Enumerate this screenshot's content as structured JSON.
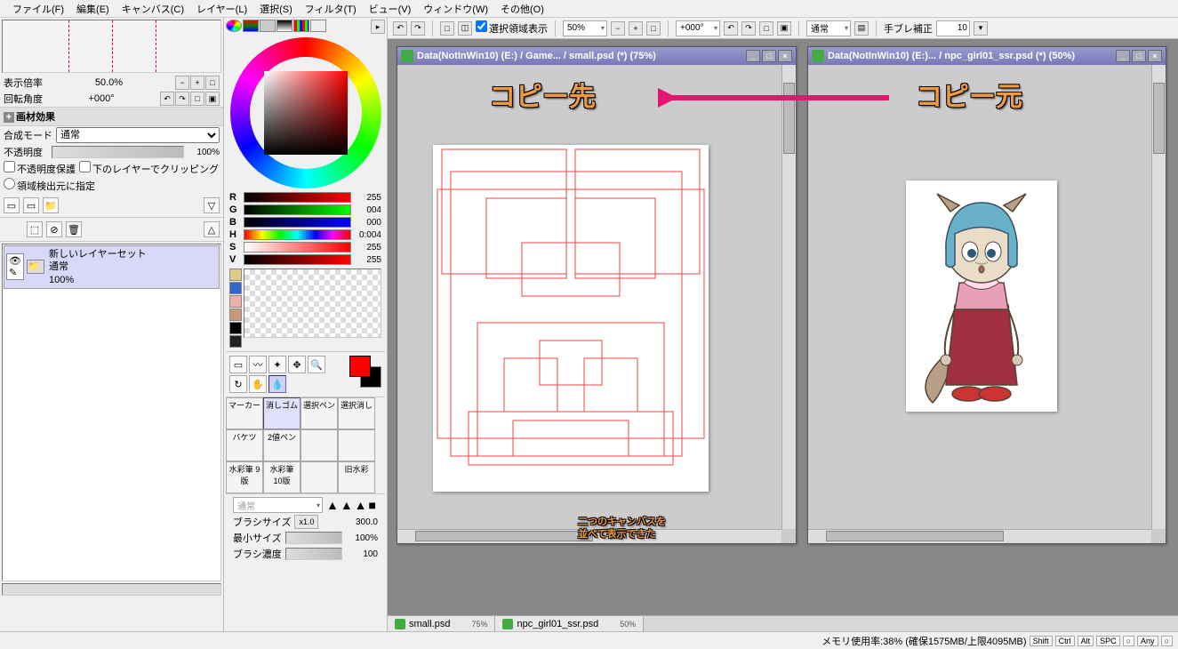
{
  "menu": [
    "ファイル(F)",
    "編集(E)",
    "キャンバス(C)",
    "レイヤー(L)",
    "選択(S)",
    "フィルタ(T)",
    "ビュー(V)",
    "ウィンドウ(W)",
    "その他(O)"
  ],
  "nav": {
    "zoom_label": "表示倍率",
    "zoom": "50.0%",
    "rot_label": "回転角度",
    "rot": "+000°"
  },
  "material": {
    "header": "画材効果",
    "blend_label": "合成モード",
    "blend_value": "通常",
    "opacity_label": "不透明度",
    "opacity_value": "100%",
    "protect_alpha": "不透明度保護",
    "clip_below": "下のレイヤーでクリッピング",
    "select_src": "領域検出元に指定"
  },
  "layer": {
    "name": "新しいレイヤーセット",
    "mode": "通常",
    "opacity": "100%"
  },
  "rgb": {
    "R": "255",
    "G": "004",
    "B": "000",
    "H": "0:004",
    "S": "255",
    "V": "255"
  },
  "brush_tabs": [
    "マーカー",
    "消しゴム",
    "選択ペン",
    "選択消し",
    "バケツ",
    "2値ペン",
    "",
    "",
    "水彩筆 9版",
    "水彩筆 10版",
    "",
    "旧水彩"
  ],
  "brush_opts": {
    "mode": "通常",
    "size_label": "ブラシサイズ",
    "size_mul": "x1.0",
    "size": "300.0",
    "min_label": "最小サイズ",
    "min": "100%",
    "density_label": "ブラシ濃度",
    "density": "100"
  },
  "toolbar": {
    "show_sel": "選択領域表示",
    "zoom": "50%",
    "rot": "+000°",
    "blend": "通常",
    "stabilize_label": "手ブレ補正",
    "stabilize": "10"
  },
  "doc1": {
    "title": "Data(NotInWin10) (E:) / Game... / small.psd (*) (75%)"
  },
  "doc2": {
    "title": "Data(NotInWin10) (E:)... / npc_girl01_ssr.psd (*) (50%)"
  },
  "tabs": {
    "t1": "small.psd",
    "t1pct": "75%",
    "t2": "npc_girl01_ssr.psd",
    "t2pct": "50%"
  },
  "anno": {
    "dest": "コピー先",
    "src": "コピー元",
    "bottom1": "二つのキャンバスを",
    "bottom2": "並べて表示できた"
  },
  "status": {
    "mem": "メモリ使用率:38% (確保1575MB/上限4095MB)",
    "keys": [
      "Shift",
      "Ctrl",
      "Alt",
      "SPC",
      "○",
      "Any",
      "○"
    ]
  }
}
